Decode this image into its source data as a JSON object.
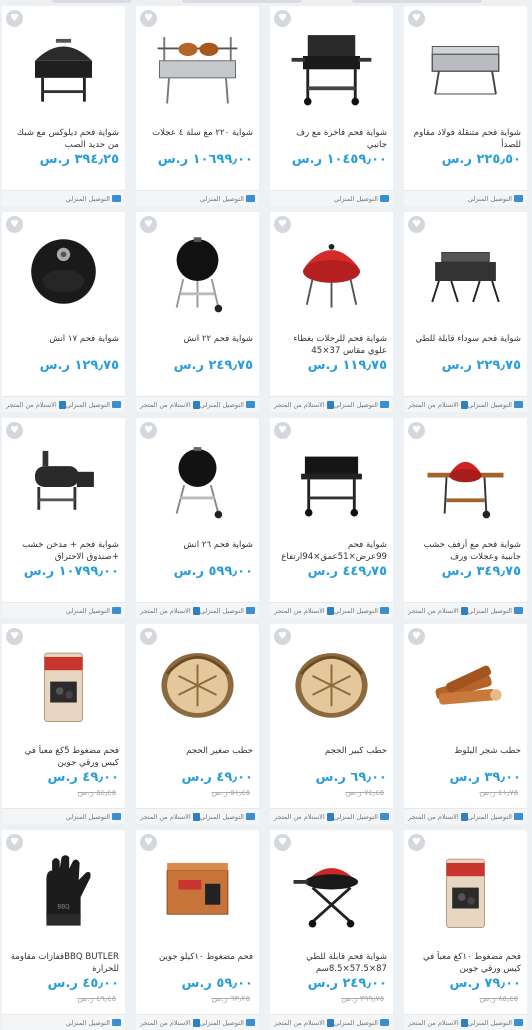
{
  "labels": {
    "delivery": "التوصيل المنزلي",
    "pickup": "الاستلام من المتجر"
  },
  "colors": {
    "price": "#2a9fd6",
    "accent": "#3a8fd0",
    "background": "#eef1f4"
  },
  "products": [
    {
      "name": "شواية فحم متنقلة فولاذ مقاوم للصدأ",
      "price": "٢٢٥٫٥٠ ر.س",
      "old_price": "",
      "pickup": false,
      "image": "steel-grill"
    },
    {
      "name": "شواية فحم فاخرة مع رف جانبي",
      "price": "١٠٤٥٩٫٠٠ ر.س",
      "old_price": "",
      "pickup": false,
      "image": "barrel-grill"
    },
    {
      "name": "شواية ٢٢٠ مع سلة ٤ عجلات",
      "price": "١٠٦٩٩٫٠٠ ر.س",
      "old_price": "",
      "pickup": false,
      "image": "rotisserie-grill"
    },
    {
      "name": "شواية فحم ديلوكس مع شبك من حديد الصب",
      "price": "٣٩٤٫٢٥ ر.س",
      "old_price": "",
      "pickup": false,
      "image": "drum-grill"
    },
    {
      "name": "شواية فحم سوداء قابلة للطي",
      "price": "٢٢٩٫٧٥ ر.س",
      "old_price": "",
      "pickup": true,
      "image": "box-grill"
    },
    {
      "name": "شواية فحم للرحلات بغطاء علوي مقاس 37×45",
      "price": "١١٩٫٧٥ ر.س",
      "old_price": "",
      "pickup": true,
      "image": "red-kettle"
    },
    {
      "name": "شواية فحم ٢٢ انش",
      "price": "٢٤٩٫٧٥ ر.س",
      "old_price": "",
      "pickup": true,
      "image": "black-kettle"
    },
    {
      "name": "شواية فحم ١٧ انش",
      "price": "١٢٩٫٧٥ ر.س",
      "old_price": "",
      "pickup": true,
      "image": "round-black"
    },
    {
      "name": "شواية فحم مع أرفف خشب جانبية وعجلات ورف",
      "price": "٣٤٩٫٧٥ ر.س",
      "old_price": "",
      "pickup": true,
      "image": "red-kettle-wood"
    },
    {
      "name": "شواية فحم 99عرض×51عمق×94ارتفاع سم",
      "price": "٤٤٩٫٧٥ ر.س",
      "old_price": "",
      "pickup": true,
      "image": "cart-grill"
    },
    {
      "name": "شواية فحم ٢٦ انش",
      "price": "٥٩٩٫٠٠ ر.س",
      "old_price": "",
      "pickup": true,
      "image": "kettle-stand"
    },
    {
      "name": "شواية فحم + مدخن خشب +صندوق الاحتراق",
      "price": "١٠٧٩٩٫٠٠ ر.س",
      "old_price": "",
      "pickup": false,
      "image": "smoker"
    },
    {
      "name": "حطب شجر البلوط",
      "price": "٣٩٫٠٠ ر.س",
      "old_price": "٤١٫٧٥ ر.س",
      "pickup": true,
      "image": "oak-logs"
    },
    {
      "name": "حطب كبير الحجم",
      "price": "٦٩٫٠٠ ر.س",
      "old_price": "٧٤٫٤٥ ر.س",
      "pickup": true,
      "image": "log-bundle"
    },
    {
      "name": "حطب صغير الحجم",
      "price": "٤٩٫٠٠ ر.س",
      "old_price": "٥١٫٤٥ ر.س",
      "pickup": true,
      "image": "log-bundle"
    },
    {
      "name": "فحم مضغوط 5كغ معبأ في كيس ورقي جوين",
      "price": "٤٩٫٠٠ ر.س",
      "old_price": "٥٤٫٤٥ ر.س",
      "pickup": false,
      "image": "charcoal-bag"
    },
    {
      "name": "فحم مضغوط ١٠كغ معبأ في كيس ورقي جوين",
      "price": "٧٩٫٠٠ ر.س",
      "old_price": "٨٥٫٤٥ ر.س",
      "pickup": true,
      "image": "charcoal-bag"
    },
    {
      "name": "شواية فحم قابلة للطي 87×57.5×8.5سم",
      "price": "٢٤٩٫٠٠ ر.س",
      "old_price": "٣٩٩٫٧٥ ر.س",
      "pickup": true,
      "image": "red-portable"
    },
    {
      "name": "فحم مضغوط ١٠كيلو جوين",
      "price": "٥٩٫٠٠ ر.س",
      "old_price": "٦٣٫٢٥ ر.س",
      "pickup": true,
      "image": "charcoal-box"
    },
    {
      "name": "BBQ BUTLERقفازات مقاومة للحرارة",
      "price": "٤٥٫٠٠ ر.س",
      "old_price": "٤٩٫٤٥ ر.س",
      "pickup": false,
      "image": "glove"
    }
  ]
}
